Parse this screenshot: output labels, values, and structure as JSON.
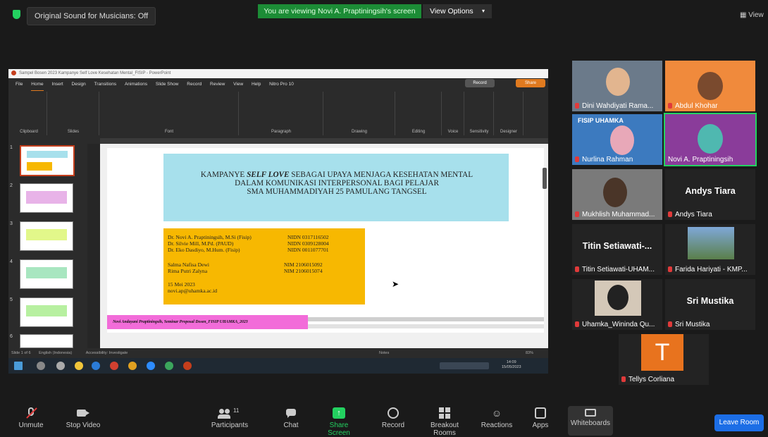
{
  "topbar": {
    "original_sound": "Original Sound for Musicians: Off",
    "viewing_banner": "You are viewing Novi A. Praptiningsih's screen",
    "view_options": "View Options",
    "view_button": "View"
  },
  "ppt": {
    "title_bar": "Sampel Bosen 2023 Kampanye Self Love Kesehatan Mental_FISIP - PowerPoint",
    "menu_tabs": [
      "File",
      "Home",
      "Insert",
      "Design",
      "Transitions",
      "Animations",
      "Slide Show",
      "Record",
      "Review",
      "View",
      "Help",
      "Nitro Pro 10"
    ],
    "record_btn": "Record",
    "share_btn": "Share",
    "groups": [
      "Clipboard",
      "Slides",
      "Font",
      "Paragraph",
      "Drawing",
      "Editing",
      "Voice",
      "Sensitivity",
      "Designer"
    ],
    "slide_numbers": [
      "1",
      "2",
      "3",
      "4",
      "5",
      "6"
    ],
    "slide": {
      "heading_line1_pre": "KAMPANYE ",
      "heading_line1_em": "SELF LOVE",
      "heading_line1_post": " SEBAGAI UPAYA MENJAGA KESEHATAN MENTAL",
      "heading_line2": "DALAM KOMUNIKASI INTERPERSONAL BAGI PELAJAR",
      "heading_line3": "SMA MUHAMMADIYAH 25 PAMULANG TANGSEL",
      "authors": [
        {
          "name": "Dr. Novi A. Praptiningsih, M.Si (Fisip)",
          "id": "NIDN 0317116502"
        },
        {
          "name": "Dr. Silvie Mill, M.Pd. (PAUD)",
          "id": "NIDN 0309128004"
        },
        {
          "name": "Dr. Eko Dasdiyo, M.Hum. (Fisip)",
          "id": "NIDN 0011077701"
        }
      ],
      "students": [
        {
          "name": "Salma Nafisa Dewi",
          "id": "NIM 2106015092"
        },
        {
          "name": "Rima Putri Zalyna",
          "id": "NIM 2106015074"
        }
      ],
      "date": "15 Mei 2023",
      "email": "novi.ap@uhamka.ac.id",
      "footer": "Novi Andayani Praptiningsih, Seminar Proposal Dosen_FISIP UHAMKA_2023"
    },
    "status_left": "Slide 1 of 6",
    "status_lang": "English (Indonesia)",
    "status_access": "Accessibility: Investigate",
    "status_notes": "Notes",
    "zoom": "83%",
    "clock_time": "14:09",
    "clock_date": "15/05/2023"
  },
  "participants": [
    {
      "name": "Dini Wahdiyati Rama...",
      "label": ""
    },
    {
      "name": "Abdul Khohar",
      "label": ""
    },
    {
      "name": "Nurlina Rahman",
      "label": ""
    },
    {
      "name": "Novi A. Praptiningsih",
      "label": ""
    },
    {
      "name": "Mukhlish Muhammad...",
      "label": ""
    },
    {
      "name": "Andys Tiara",
      "label": "Andys Tiara"
    },
    {
      "name": "Titin Setiawati-UHAM...",
      "label": "Titin Setiawati-..."
    },
    {
      "name": "Farida Hariyati - KMP...",
      "label": ""
    },
    {
      "name": "Uhamka_Wininda Qu...",
      "label": ""
    },
    {
      "name": "Sri Mustika",
      "label": "Sri Mustika"
    },
    {
      "name": "Tellys Corliana",
      "label": ""
    }
  ],
  "tile_texts": {
    "fisip": "FISIP UHAMKA",
    "avatar_letter": "T"
  },
  "toolbar": {
    "unmute": "Unmute",
    "stop_video": "Stop Video",
    "participants": "Participants",
    "participants_count": "11",
    "chat": "Chat",
    "share_screen": "Share Screen",
    "record": "Record",
    "breakout": "Breakout Rooms",
    "reactions": "Reactions",
    "apps": "Apps",
    "whiteboards": "Whiteboards",
    "leave": "Leave Room"
  },
  "colors": {
    "zoom_green": "#23d160",
    "leave_blue": "#1c6ee6",
    "header_box": "#a7e0ec",
    "info_box": "#f7b801",
    "footer_bar": "#f26cd9"
  }
}
